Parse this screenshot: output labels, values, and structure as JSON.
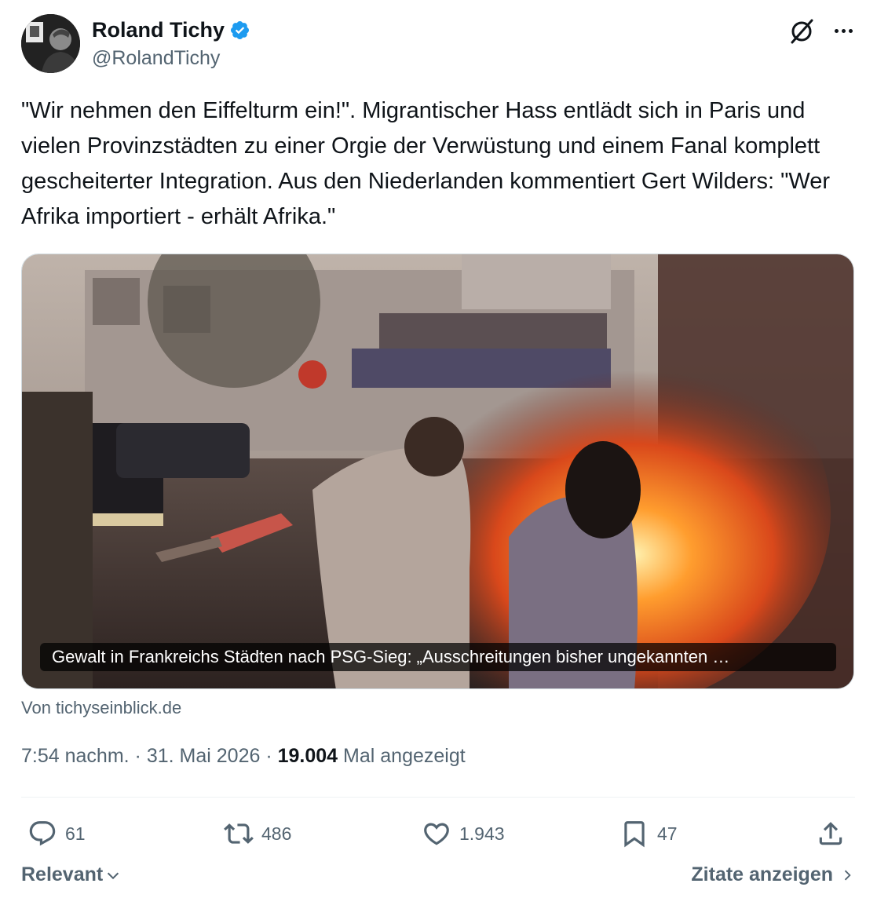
{
  "author": {
    "display_name": "Roland Tichy",
    "handle": "@RolandTichy",
    "verified_color": "#1d9bf0"
  },
  "tweet": {
    "text": "\"Wir nehmen den Eiffelturm ein!\". Migrantischer Hass entlädt sich in Paris und vielen Provinzstädten zu einer Orgie der Verwüstung und einem Fanal komplett gescheiterter Integration. Aus den Niederlanden kommentiert Gert Wilders: \"Wer Afrika importiert - erhält Afrika.\""
  },
  "card": {
    "caption": "Gewalt in Frankreichs Städten nach PSG-Sieg: „Ausschreitungen bisher ungekannten …",
    "source": "Von tichyseinblick.de"
  },
  "meta": {
    "time": "7:54 nachm.",
    "date": "31. Mai 2026",
    "views": "19.004",
    "views_label": "Mal angezeigt"
  },
  "actions": {
    "replies": "61",
    "reposts": "486",
    "likes": "1.943",
    "bookmarks": "47"
  },
  "footer": {
    "sort_label": "Relevant",
    "quotes_label": "Zitate anzeigen"
  },
  "icons": [
    "verified-icon",
    "grok-icon",
    "more-icon",
    "reply-icon",
    "repost-icon",
    "like-icon",
    "bookmark-icon",
    "share-icon",
    "chevron-down-icon",
    "chevron-right-icon"
  ]
}
